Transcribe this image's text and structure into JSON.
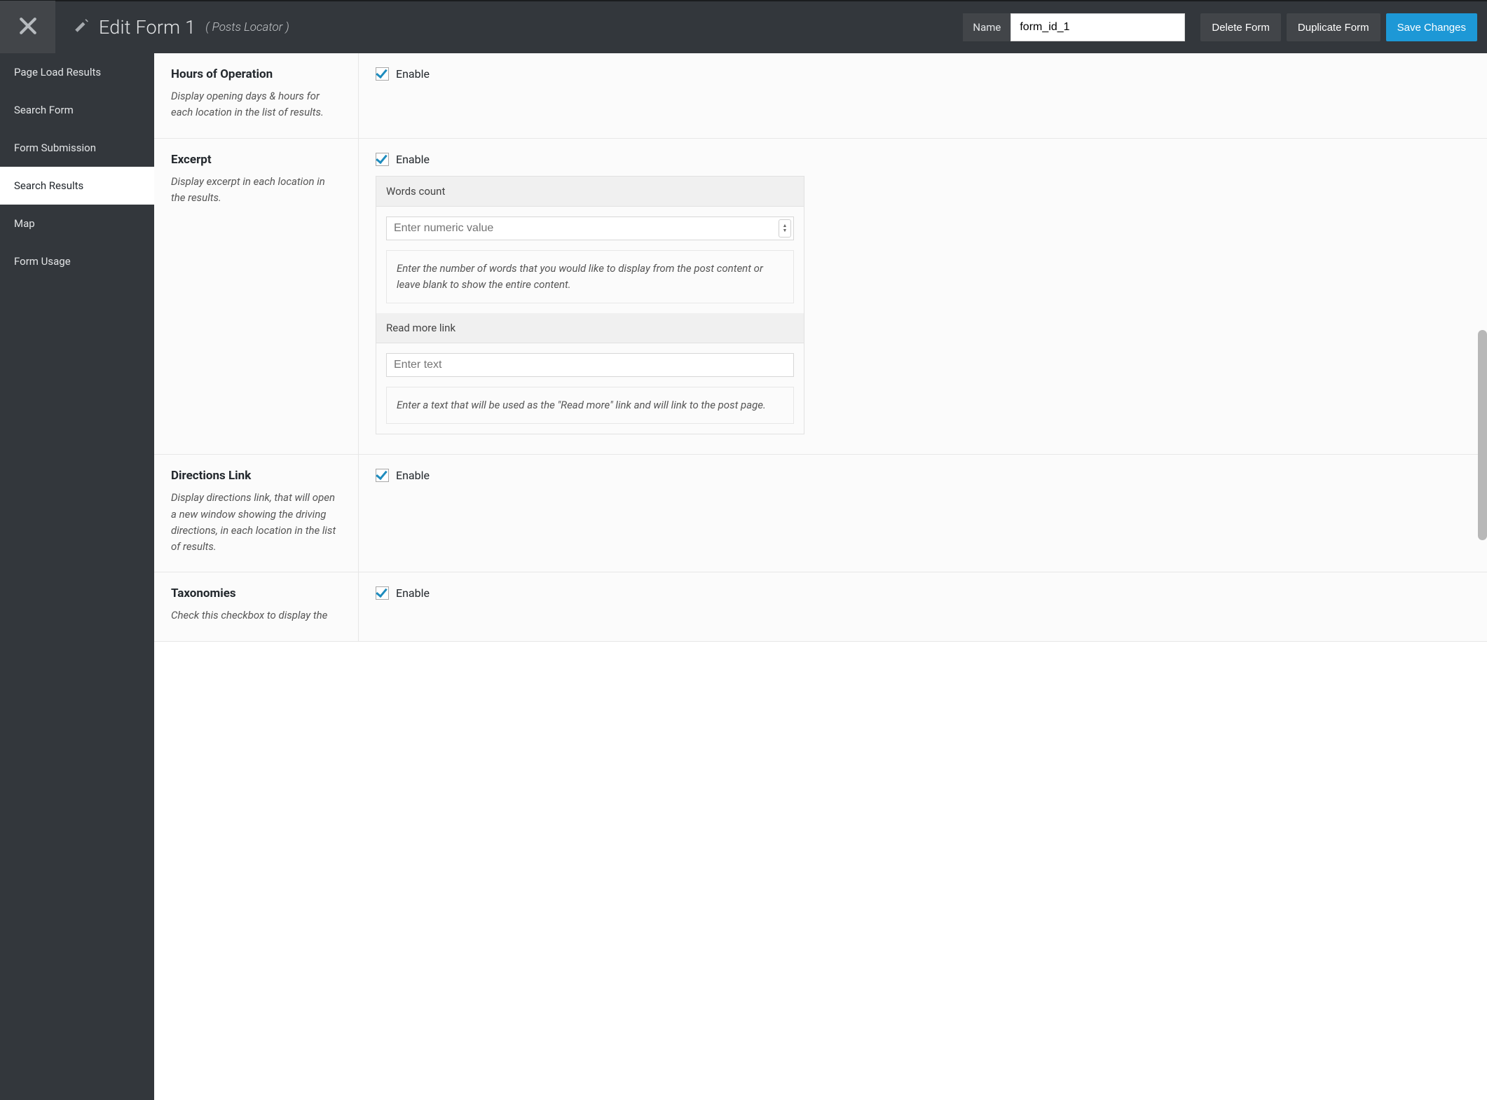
{
  "header": {
    "title": "Edit Form 1",
    "subtitle": "( Posts Locator )",
    "name_label": "Name",
    "name_value": "form_id_1",
    "delete_label": "Delete Form",
    "duplicate_label": "Duplicate Form",
    "save_label": "Save Changes"
  },
  "sidebar": {
    "items": [
      {
        "label": "Page Load Results",
        "slug": "page-load-results"
      },
      {
        "label": "Search Form",
        "slug": "search-form"
      },
      {
        "label": "Form Submission",
        "slug": "form-submission"
      },
      {
        "label": "Search Results",
        "slug": "search-results",
        "active": true
      },
      {
        "label": "Map",
        "slug": "map"
      },
      {
        "label": "Form Usage",
        "slug": "form-usage"
      }
    ]
  },
  "rows": {
    "hours": {
      "title": "Hours of Operation",
      "desc": "Display opening days & hours for each location in the list of results.",
      "enable_label": "Enable",
      "checked": true
    },
    "excerpt": {
      "title": "Excerpt",
      "desc": "Display excerpt in each location in the results.",
      "enable_label": "Enable",
      "checked": true,
      "words": {
        "heading": "Words count",
        "placeholder": "Enter numeric value",
        "help": "Enter the number of words that you would like to display from the post content or leave blank to show the entire content."
      },
      "readmore": {
        "heading": "Read more link",
        "placeholder": "Enter text",
        "help": "Enter a text that will be used as the \"Read more\" link and will link to the post page."
      }
    },
    "directions": {
      "title": "Directions Link",
      "desc": "Display directions link, that will open a new window showing the driving directions, in each location in the list of results.",
      "enable_label": "Enable",
      "checked": true
    },
    "taxonomies": {
      "title": "Taxonomies",
      "desc": "Check this checkbox to display the",
      "enable_label": "Enable",
      "checked": true
    }
  }
}
